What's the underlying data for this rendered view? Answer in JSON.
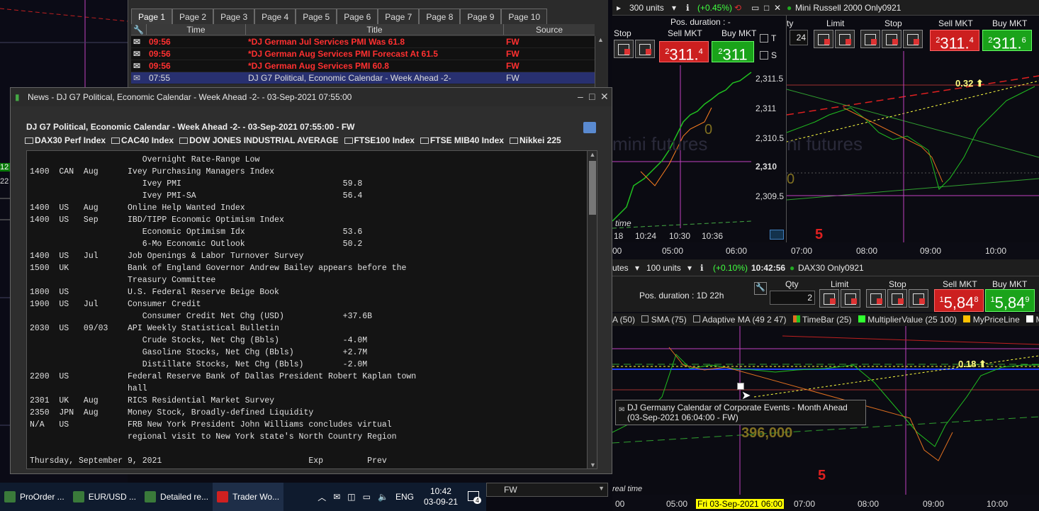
{
  "news_list": {
    "tabs": [
      "Page 1",
      "Page 2",
      "Page 3",
      "Page 4",
      "Page 5",
      "Page 6",
      "Page 7",
      "Page 8",
      "Page 9",
      "Page 10"
    ],
    "columns": {
      "time": "Time",
      "title": "Title",
      "source": "Source"
    },
    "rows": [
      {
        "time": "09:56",
        "title": "*DJ German Jul Services PMI Was 61.8",
        "source": "FW",
        "style": "red"
      },
      {
        "time": "09:56",
        "title": "*DJ German Aug Services PMI Forecast At 61.5",
        "source": "FW",
        "style": "red"
      },
      {
        "time": "09:56",
        "title": "*DJ German Aug Services PMI 60.8",
        "source": "FW",
        "style": "red"
      },
      {
        "time": "07:55",
        "title": "DJ G7 Political, Economic Calendar - Week Ahead -2-",
        "source": "FW",
        "style": "sel"
      }
    ],
    "bottom_source": "FW"
  },
  "news_window": {
    "title": "News - DJ G7 Political, Economic Calendar - Week Ahead -2- - 03-Sep-2021 07:55:00",
    "headline": "DJ G7 Political, Economic Calendar - Week Ahead -2- - 03-Sep-2021 07:55:00 - FW",
    "indices": [
      "DAX30 Perf Index",
      "CAC40 Index",
      "DOW JONES INDUSTRIAL AVERAGE",
      "FTSE100 Index",
      "FTSE MIB40 Index",
      "Nikkei 225"
    ],
    "body_lines": [
      "                       Overnight Rate-Range Low",
      "1400  CAN  Aug      Ivey Purchasing Managers Index",
      "                       Ivey PMI                                 59.8",
      "                       Ivey PMI-SA                              56.4",
      "1400  US   Aug      Online Help Wanted Index",
      "1400  US   Sep      IBD/TIPP Economic Optimism Index",
      "                       Economic Optimism Idx                    53.6",
      "                       6-Mo Economic Outlook                    50.2",
      "1400  US   Jul      Job Openings & Labor Turnover Survey",
      "1500  UK            Bank of England Governor Andrew Bailey appears before the",
      "                    Treasury Committee",
      "1800  US            U.S. Federal Reserve Beige Book",
      "1900  US   Jul      Consumer Credit",
      "                       Consumer Credit Net Chg (USD)            +37.6B",
      "2030  US   09/03    API Weekly Statistical Bulletin",
      "                       Crude Stocks, Net Chg (Bbls)             -4.0M",
      "                       Gasoline Stocks, Net Chg (Bbls)          +2.7M",
      "                       Distillate Stocks, Net Chg (Bbls)        -2.0M",
      "2200  US            Federal Reserve Bank of Dallas President Robert Kaplan town",
      "                    hall",
      "2301  UK   Aug      RICS Residential Market Survey",
      "2350  JPN  Aug      Money Stock, Broadly-defined Liquidity",
      "N/A   US            FRB New York President John Williams concludes virtual",
      "                    regional visit to New York state's North Country Region",
      "",
      "Thursday, September 9, 2021                              Exp         Prev"
    ]
  },
  "russell_pane": {
    "units": "300 units",
    "change": "(+0.45%)",
    "instrument": "Mini Russell 2000 Only0921",
    "pos_duration": "Pos. duration : -",
    "sell_label": "Sell MKT",
    "buy_label": "Buy MKT",
    "sell_prefix": "2",
    "sell_main": "311.",
    "sell_sup": "4",
    "buy_prefix": "2",
    "buy_main": "311",
    "sell_label2": "Sell MKT",
    "buy_label2": "Buy MKT",
    "sell2_main": "311.",
    "sell2_sup": "4",
    "buy2_main": "311.",
    "buy2_sup": "6",
    "stop": "Stop",
    "limit": "Limit",
    "stop2": "Stop",
    "qty_partial": "ty",
    "qty_value": "24",
    "t_label": "T",
    "s_label": "S",
    "prices": [
      "2,311.5",
      "2,311",
      "2,310.5",
      "2,310",
      "2,309.5"
    ],
    "mini_times": [
      "18",
      "10:24",
      "10:30",
      "10:36"
    ],
    "times": [
      "00",
      "05:00",
      "06:00",
      "07:00",
      "08:00",
      "09:00",
      "10:00"
    ],
    "time_label": "time",
    "watermark": "mini futures",
    "watermark2": "ni futures",
    "annotation": "0.32",
    "count": "5",
    "zero": "0"
  },
  "dax_pane": {
    "prefix": "utes",
    "units": "100 units",
    "change": "(+0.10%)",
    "clock": "10:42:56",
    "instrument": "DAX30 Only0921",
    "pos_duration": "Pos. duration : 1D 22h",
    "qty_label": "Qty",
    "qty_value": "2",
    "limit": "Limit",
    "stop": "Stop",
    "sell_label": "Sell MKT",
    "buy_label": "Buy MKT",
    "sell_main": "5,84",
    "sell_sup": "8",
    "buy_main": "5,84",
    "buy_sup": "9",
    "indicators": [
      "A (50)",
      "SMA (75)",
      "Adaptive MA (49 2 47)",
      "TimeBar (25)",
      "MultiplierValue (25 100)",
      "MyPriceLine",
      "My"
    ],
    "tooltip_title": "DJ Germany Calendar of Corporate Events - Month Ahead",
    "tooltip_sub": "(03-Sep-2021 06:04:00 - FW)",
    "big_value": "396,000",
    "annotation": "0.18",
    "count": "5",
    "times": [
      "00",
      "05:00",
      "06:00",
      "07:00",
      "08:00",
      "09:00",
      "10:00"
    ],
    "date_marker": "Fri 03-Sep-2021 06:00",
    "realtime": "real time"
  },
  "taskbar": {
    "items": [
      "ProOrder ...",
      "EUR/USD ...",
      "Detailed re...",
      "Trader Wo..."
    ],
    "lang": "ENG",
    "time": "10:42",
    "date": "03-09-21",
    "notif": "4"
  },
  "left_edge": {
    "v1": "12",
    "v2": "22"
  },
  "colors": {
    "red": "#ff3030",
    "sell": "#cc1f1f",
    "buy": "#1aa31a",
    "selrow": "#283070",
    "yellow": "#ffff40"
  }
}
